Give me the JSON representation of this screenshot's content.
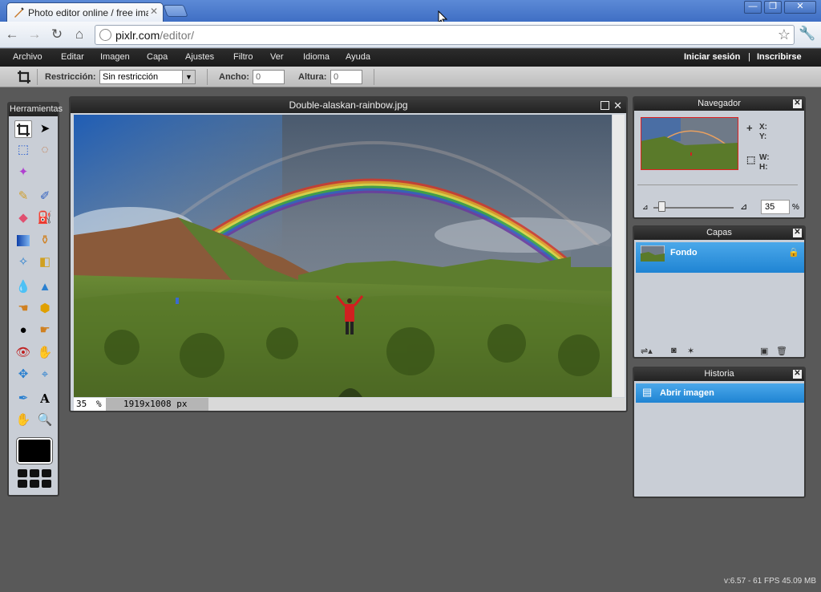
{
  "browser": {
    "tab_title": "Photo editor online / free imag",
    "tab_close": "✕",
    "url_domain": "pixlr.com",
    "url_path": "/editor/",
    "window_buttons": [
      "—",
      "❐",
      "✕"
    ]
  },
  "menu": {
    "items": [
      "Archivo",
      "Editar",
      "Imagen",
      "Capa",
      "Ajustes",
      "Filtro",
      "Ver",
      "Idioma",
      "Ayuda"
    ],
    "login": "Iniciar sesión",
    "separator": "|",
    "signup": "Inscribirse"
  },
  "options": {
    "restriction_label": "Restricción:",
    "restriction_value": "Sin restricción",
    "width_label": "Ancho:",
    "width_value": "0",
    "height_label": "Altura:",
    "height_value": "0"
  },
  "toolbox": {
    "title": "Herramientas"
  },
  "image_window": {
    "title": "Double-alaskan-rainbow.jpg",
    "zoom_value": "35",
    "zoom_unit": "%",
    "dimensions": "1919x1008 px"
  },
  "navigator": {
    "title": "Navegador",
    "x_label": "X:",
    "y_label": "Y:",
    "w_label": "W:",
    "h_label": "H:",
    "zoom_value": "35",
    "zoom_unit": "%",
    "zoom_fraction": 0.1
  },
  "layers": {
    "title": "Capas",
    "items": [
      {
        "name": "Fondo",
        "locked": true
      }
    ]
  },
  "history": {
    "title": "Historia",
    "items": [
      "Abrir imagen"
    ]
  },
  "footer": {
    "version": "v:6.57 - 61 FPS 45.09 MB"
  },
  "colors": {
    "accent": "#1f84d3",
    "foreground_color": "#000000"
  }
}
